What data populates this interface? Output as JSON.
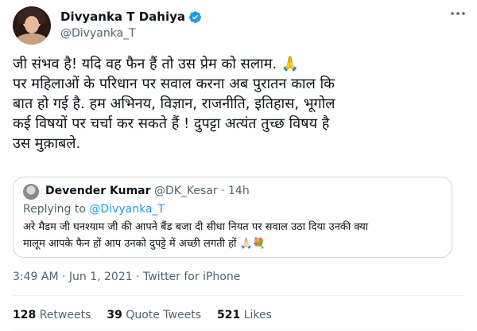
{
  "author": {
    "display_name": "Divyanka T Dahiya",
    "handle": "@Divyanka_T",
    "verified_color": "#1d9bf0"
  },
  "tweet": {
    "lines": [
      "जी संभव है! यदि वह फैन हैं तो उस प्रेम को सलाम. 🙏",
      "पर महिलाओं के परिधान पर सवाल करना अब पुरातन काल कि",
      "बात हो गई है. हम अभिनय, विज्ञान, राजनीति, इतिहास, भूगोल",
      "कई विषयों पर चर्चा कर सकते हैं ! दुपट्टा अत्यंत तुच्छ विषय है",
      "उस मुक़ाबले."
    ]
  },
  "quote": {
    "name": "Devender Kumar",
    "handle": "@DK_Kesar",
    "separator": "·",
    "time": "14h",
    "replying_prefix": "Replying to",
    "replying_to": "@Divyanka_T",
    "body_lines": [
      "अरे मैडम जी घनश्याम जी की आपने बैंड बजा दी सीधा नियत पर सवाल उठा दिया उनकी क्या",
      "मालूम आपके फैन हों आप उनको दुपट्टे में अच्छी लगती हों 🙏🏻💐"
    ]
  },
  "meta": {
    "timestamp": "3:49 AM · Jun 1, 2021 · Twitter for iPhone"
  },
  "stats": {
    "retweets_count": "128",
    "retweets_label": "Retweets",
    "quotes_count": "39",
    "quotes_label": "Quote Tweets",
    "likes_count": "521",
    "likes_label": "Likes"
  },
  "icons": {
    "verified": "verified-badge-icon",
    "more": "more-options-icon"
  }
}
